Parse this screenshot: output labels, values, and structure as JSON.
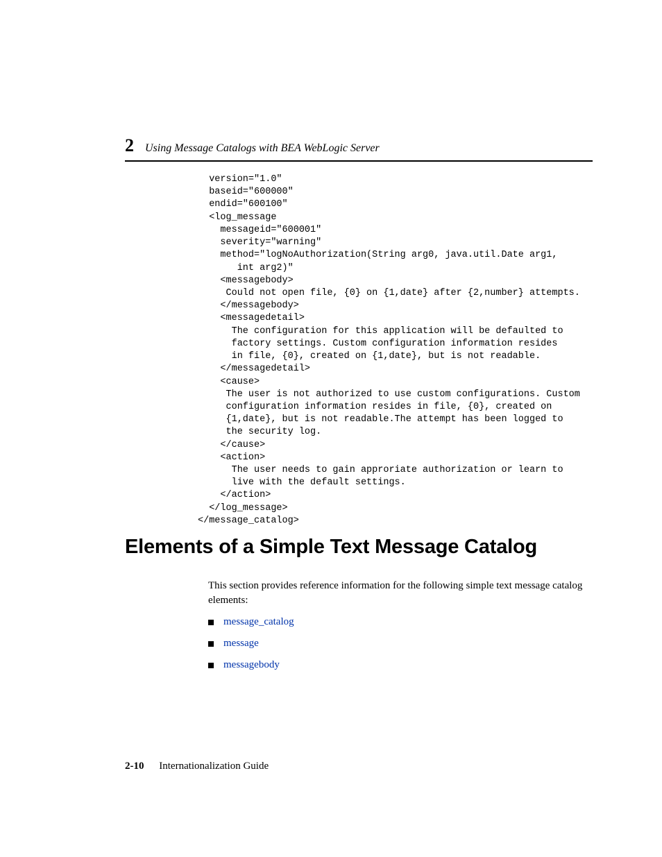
{
  "header": {
    "chapter_number": "2",
    "chapter_title": "Using Message Catalogs with BEA WebLogic Server"
  },
  "code": "  version=\"1.0\"\n  baseid=\"600000\"\n  endid=\"600100\"\n  <log_message\n    messageid=\"600001\"\n    severity=\"warning\"\n    method=\"logNoAuthorization(String arg0, java.util.Date arg1,\n       int arg2)\"\n    <messagebody>\n     Could not open file, {0} on {1,date} after {2,number} attempts.\n    </messagebody>\n    <messagedetail>\n      The configuration for this application will be defaulted to\n      factory settings. Custom configuration information resides\n      in file, {0}, created on {1,date}, but is not readable.\n    </messagedetail>\n    <cause>\n     The user is not authorized to use custom configurations. Custom\n     configuration information resides in file, {0}, created on\n     {1,date}, but is not readable.The attempt has been logged to\n     the security log.\n    </cause>\n    <action>\n      The user needs to gain approriate authorization or learn to\n      live with the default settings.\n    </action>\n  </log_message>\n</message_catalog>",
  "section": {
    "heading": "Elements of a Simple Text Message Catalog",
    "intro": "This section provides reference information for the following simple text message catalog elements:",
    "links": {
      "l1": "message_catalog",
      "l2": "message",
      "l3": "messagebody"
    }
  },
  "footer": {
    "page": "2-10",
    "title": "Internationalization Guide"
  }
}
